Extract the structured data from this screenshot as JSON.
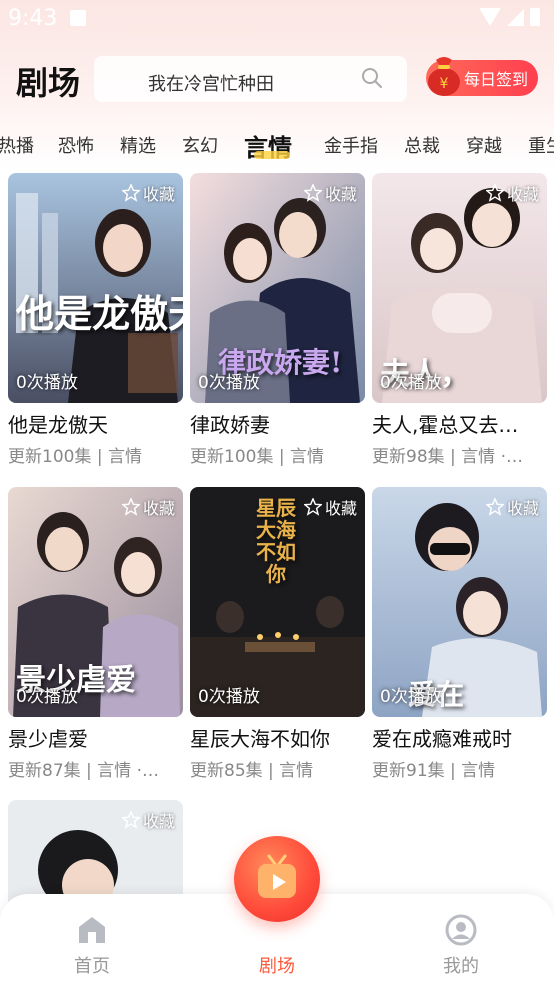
{
  "status_bar": {
    "time": "9:43"
  },
  "header": {
    "title": "剧场",
    "search_text": "我在冷宫忙种田",
    "checkin_label": "每日签到"
  },
  "tabs": [
    {
      "label": "热播"
    },
    {
      "label": "恐怖"
    },
    {
      "label": "精选"
    },
    {
      "label": "玄幻"
    },
    {
      "label": "言情",
      "active": true
    },
    {
      "label": "金手指"
    },
    {
      "label": "总裁"
    },
    {
      "label": "穿越"
    },
    {
      "label": "重生"
    }
  ],
  "fav_label": "收藏",
  "dramas": [
    {
      "poster_title": "他是龙傲天",
      "plays": "0次播放",
      "title": "他是龙傲天",
      "meta": "更新100集 | 言情"
    },
    {
      "poster_title": "律政娇妻!",
      "plays": "0次播放",
      "title": "律政娇妻",
      "meta": "更新100集 | 言情"
    },
    {
      "poster_title": "夫人，",
      "plays": "0次播放",
      "title": "夫人,霍总又去…",
      "meta": "更新98集 | 言情 ·…"
    },
    {
      "poster_title": "景少虐爱",
      "plays": "0次播放",
      "title": "景少虐爱",
      "meta": "更新87集 | 言情 ·…"
    },
    {
      "poster_title": "星辰大海不如你",
      "plays": "0次播放",
      "title": "星辰大海不如你",
      "meta": "更新85集 | 言情"
    },
    {
      "poster_title": "爱在",
      "plays": "0次播放",
      "title": "爱在成瘾难戒时",
      "meta": "更新91集 | 言情"
    },
    {
      "poster_title": "",
      "plays": "",
      "title": "",
      "meta": ""
    }
  ],
  "bottom_nav": {
    "home": "首页",
    "theater": "剧场",
    "mine": "我的"
  },
  "colors": {
    "accent": "#ff5a3c",
    "tab_underline": "#ffd23f"
  }
}
